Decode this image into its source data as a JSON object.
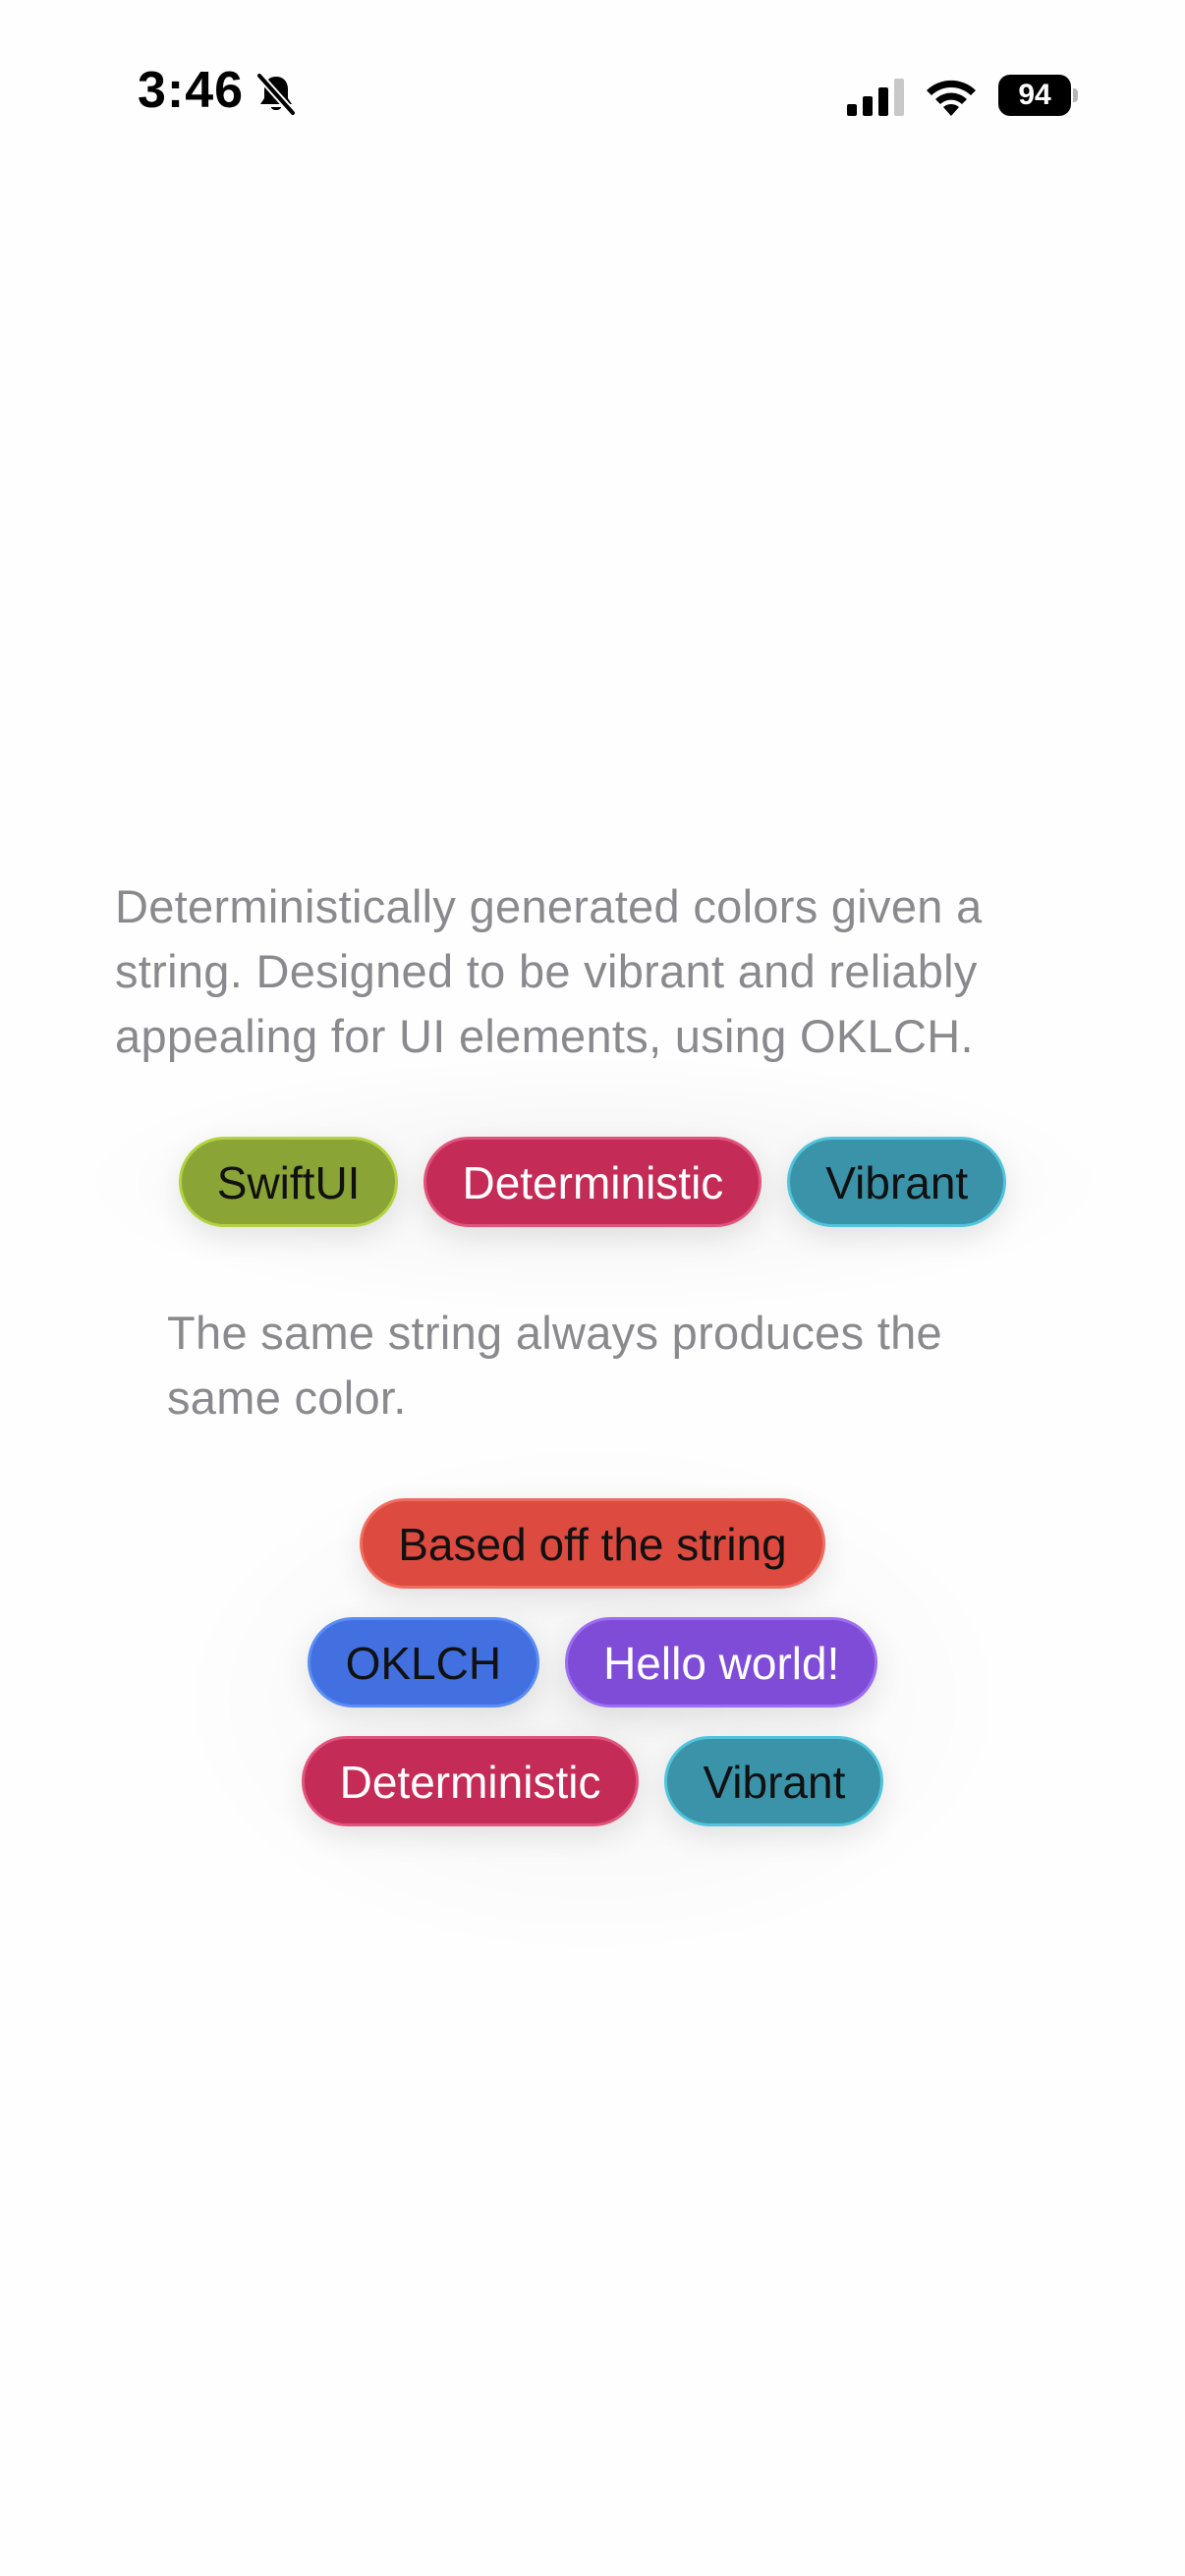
{
  "status_bar": {
    "time": "3:46",
    "battery_level": "94",
    "icons": [
      "bell-off-icon",
      "signal-icon",
      "wifi-icon",
      "battery-icon"
    ]
  },
  "description": "Deterministically generated colors given a string. Designed to be vibrant and reliably appealing for UI elements, using OKLCH.",
  "row1": [
    {
      "label": "SwiftUI",
      "bg": "#8aa436",
      "border": "#b3d23f",
      "text": "#111111"
    },
    {
      "label": "Deterministic",
      "bg": "#c42b56",
      "border": "#e0547c",
      "text": "#ffffff"
    },
    {
      "label": "Vibrant",
      "bg": "#3a93a8",
      "border": "#4fc4da",
      "text": "#111111"
    }
  ],
  "description_2": "The same string always produces the same color.",
  "row2": [
    {
      "label": "Based off the string",
      "bg": "#dc4a40",
      "border": "#ef6c60",
      "text": "#111111"
    }
  ],
  "row3": [
    {
      "label": "OKLCH",
      "bg": "#4270e0",
      "border": "#5a8df5",
      "text": "#111111"
    },
    {
      "label": "Hello world!",
      "bg": "#7f4cd8",
      "border": "#9c6ef0",
      "text": "#ffffff"
    }
  ],
  "row4": [
    {
      "label": "Deterministic",
      "bg": "#c42b56",
      "border": "#e0547c",
      "text": "#ffffff"
    },
    {
      "label": "Vibrant",
      "bg": "#3a93a8",
      "border": "#4fc4da",
      "text": "#111111"
    }
  ]
}
